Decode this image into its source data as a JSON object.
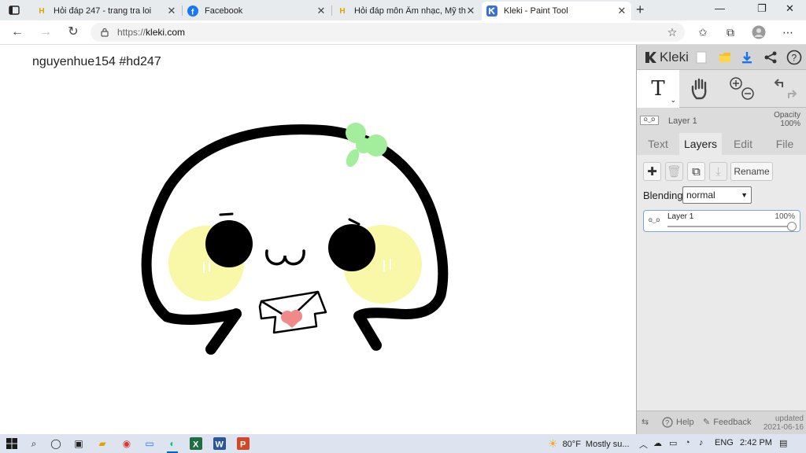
{
  "browser": {
    "tabs": [
      {
        "title": "Hỏi đáp 247 - trang tra loi",
        "icon": "hoidap-favicon"
      },
      {
        "title": "Facebook",
        "icon": "facebook-favicon"
      },
      {
        "title": "Hỏi đáp môn Âm nhạc, Mỹ thuật",
        "icon": "hoidap-favicon"
      },
      {
        "title": "Kleki - Paint Tool",
        "icon": "kleki-favicon",
        "active": true
      }
    ],
    "url_protocol": "https://",
    "url_host": "kleki.com"
  },
  "canvas": {
    "caption": "nguyenhue154 #hd247"
  },
  "kleki": {
    "logo": "Kleki",
    "layer_preview_name": "Layer 1",
    "opacity_label": "Opacity",
    "opacity_value": "100%",
    "tabs": [
      "Text",
      "Layers",
      "Edit",
      "File"
    ],
    "active_tab": "Layers",
    "rename_label": "Rename",
    "blending_label": "Blending",
    "blending_value": "normal",
    "layers": [
      {
        "name": "Layer 1",
        "opacity_label": "100%",
        "opacity": 1.0
      }
    ],
    "footer": {
      "help": "Help",
      "feedback": "Feedback",
      "updated_label": "updated",
      "updated_date": "2021-06-16"
    }
  },
  "taskbar": {
    "temperature": "80°F",
    "weather": "Mostly su...",
    "language": "ENG",
    "time": "2:42 PM"
  },
  "colors": {
    "accent": "#0067c0",
    "panel_bg": "#eaeaea",
    "cheek": "#f8f8a8",
    "leaf": "#a3ee9c",
    "heart": "#f08a8a"
  }
}
